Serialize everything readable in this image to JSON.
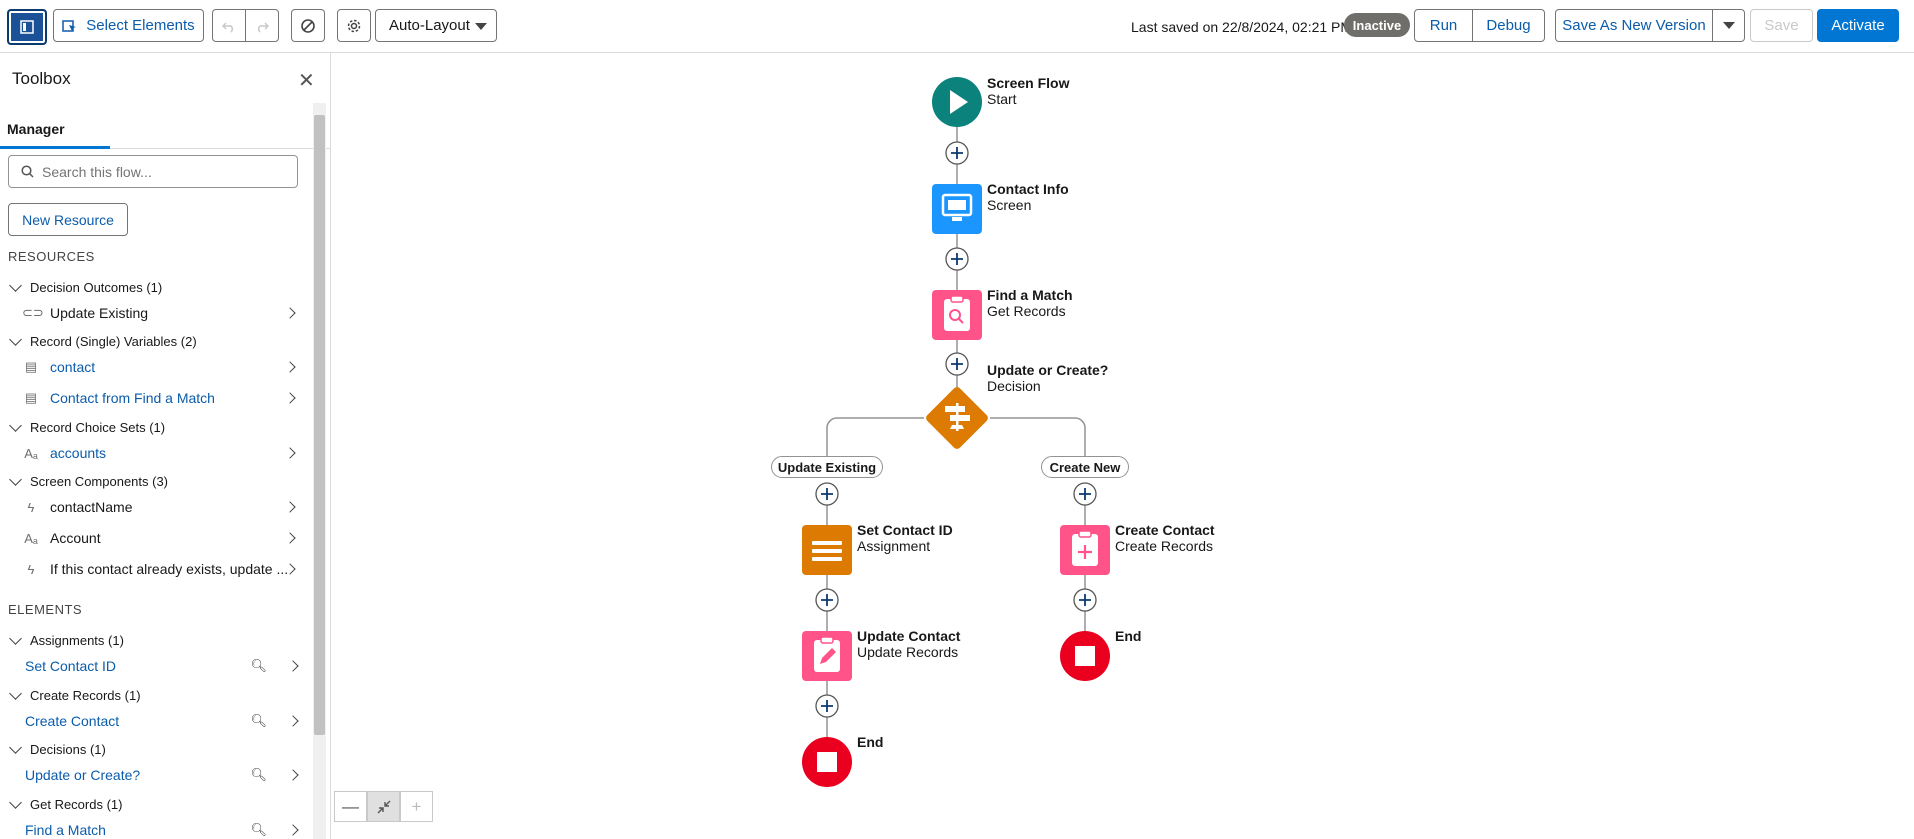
{
  "toolbar": {
    "select_elements": "Select Elements",
    "layout": "Auto-Layout",
    "last_saved": "Last saved on 22/8/2024, 02:21 PM",
    "status": "Inactive",
    "run": "Run",
    "debug": "Debug",
    "save_as_new_version": "Save As New Version",
    "save": "Save",
    "activate": "Activate"
  },
  "toolbox": {
    "title": "Toolbox",
    "tab": "Manager",
    "search_placeholder": "Search this flow...",
    "new_resource": "New Resource",
    "resources_heading": "RESOURCES",
    "resource_groups": [
      {
        "label": "Decision Outcomes (1)",
        "items": [
          "Update Existing"
        ]
      },
      {
        "label": "Record (Single) Variables (2)",
        "items": [
          "contact",
          "Contact from Find a Match"
        ]
      },
      {
        "label": "Record Choice Sets (1)",
        "items": [
          "accounts"
        ]
      },
      {
        "label": "Screen Components (3)",
        "items": [
          "contactName",
          "Account",
          "If this contact already exists, update ..."
        ]
      }
    ],
    "elements_heading": "ELEMENTS",
    "element_groups": [
      {
        "label": "Assignments (1)",
        "items": [
          "Set Contact ID"
        ]
      },
      {
        "label": "Create Records (1)",
        "items": [
          "Create Contact"
        ]
      },
      {
        "label": "Decisions (1)",
        "items": [
          "Update or Create?"
        ]
      },
      {
        "label": "Get Records (1)",
        "items": [
          "Find a Match"
        ]
      }
    ]
  },
  "flow": {
    "start": {
      "title": "Screen Flow",
      "subtitle": "Start"
    },
    "screen": {
      "title": "Contact Info",
      "subtitle": "Screen"
    },
    "get_records": {
      "title": "Find a Match",
      "subtitle": "Get Records"
    },
    "decision": {
      "title": "Update or Create?",
      "subtitle": "Decision"
    },
    "outcome_left": "Update Existing",
    "outcome_right": "Create New",
    "assignment": {
      "title": "Set Contact ID",
      "subtitle": "Assignment"
    },
    "update": {
      "title": "Update Contact",
      "subtitle": "Update Records"
    },
    "create": {
      "title": "Create Contact",
      "subtitle": "Create Records"
    },
    "end": "End"
  },
  "colors": {
    "start": "#0b827c",
    "screen": "#1b96ff",
    "records": "#ff538a",
    "decision": "#dd7a01",
    "assignment": "#dd7a01",
    "end": "#ea001e",
    "brand": "#0176d3"
  }
}
